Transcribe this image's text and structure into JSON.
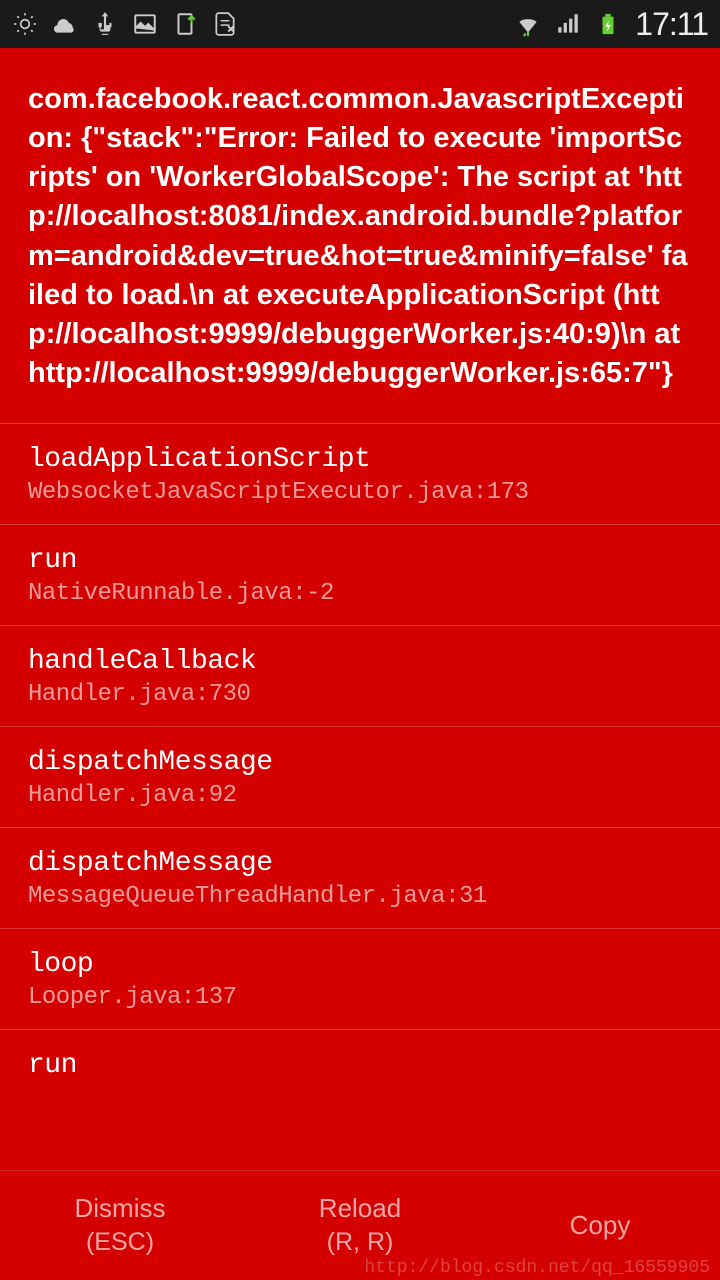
{
  "statusBar": {
    "time": "17:11"
  },
  "error": {
    "message": "com.facebook.react.common.JavascriptException: {\"stack\":\"Error: Failed to execute 'importScripts' on 'WorkerGlobalScope': The script at 'http://localhost:8081/index.android.bundle?platform=android&dev=true&hot=true&minify=false' failed to load.\\n    at executeApplicationScript (http://localhost:9999/debuggerWorker.js:40:9)\\n    at http://localhost:9999/debuggerWorker.js:65:7\"}"
  },
  "stack": [
    {
      "method": "loadApplicationScript",
      "file": "WebsocketJavaScriptExecutor.java:173"
    },
    {
      "method": "run",
      "file": "NativeRunnable.java:-2"
    },
    {
      "method": "handleCallback",
      "file": "Handler.java:730"
    },
    {
      "method": "dispatchMessage",
      "file": "Handler.java:92"
    },
    {
      "method": "dispatchMessage",
      "file": "MessageQueueThreadHandler.java:31"
    },
    {
      "method": "loop",
      "file": "Looper.java:137"
    },
    {
      "method": "run",
      "file": ""
    }
  ],
  "buttons": {
    "dismiss": {
      "label": "Dismiss",
      "sub": "(ESC)"
    },
    "reload": {
      "label": "Reload",
      "sub": "(R, R)"
    },
    "copy": {
      "label": "Copy",
      "sub": ""
    }
  },
  "watermark": "http://blog.csdn.net/qq_16559905"
}
